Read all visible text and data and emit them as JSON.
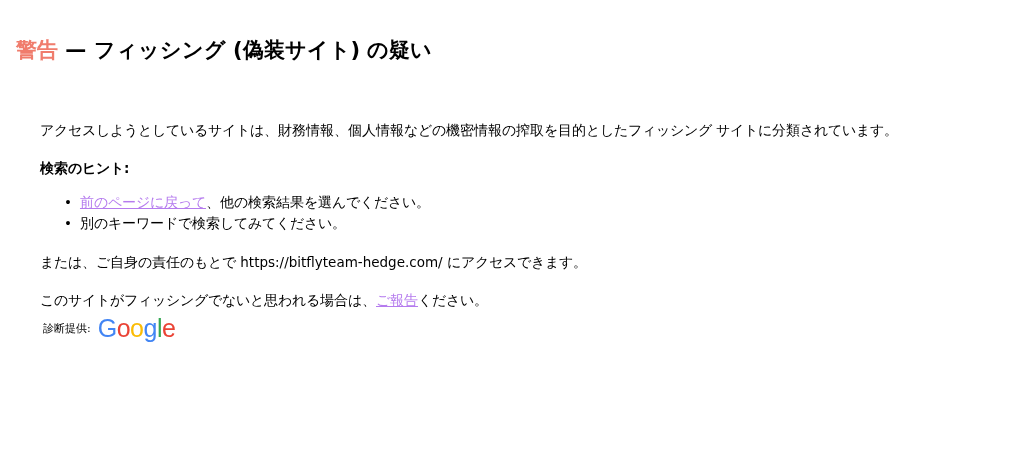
{
  "heading": {
    "label": "警告",
    "text": "— フィッシング (偽装サイト) の疑い"
  },
  "intro": "アクセスしようとしているサイトは、財務情報、個人情報などの機密情報の搾取を目的としたフィッシング サイトに分類されています。",
  "hints_title": "検索のヒント:",
  "hints": [
    {
      "bullet": "•",
      "parts": [
        {
          "kind": "link",
          "text": "前のページに戻って"
        },
        {
          "kind": "text",
          "text": "、他の検索結果を選んでください。"
        }
      ]
    },
    {
      "bullet": "•",
      "parts": [
        {
          "kind": "text",
          "text": "別のキーワードで検索してみてください。"
        }
      ]
    }
  ],
  "proceed": "または、ご自身の責任のもとで https://bitflyteam-hedge.com/ にアクセスできます。",
  "report": [
    {
      "kind": "text",
      "text": "このサイトがフィッシングでないと思われる場合は、"
    },
    {
      "kind": "link",
      "text": "ご報告"
    },
    {
      "kind": "text",
      "text": "ください。"
    }
  ],
  "provider": {
    "label": "診断提供:",
    "logo": "Google"
  }
}
